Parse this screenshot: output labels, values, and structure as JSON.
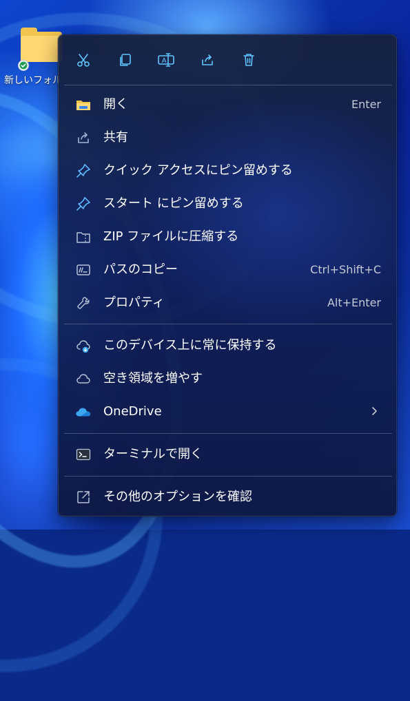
{
  "desktop": {
    "folder_label": "新しいフォル"
  },
  "context_menu": {
    "toolbar": [
      {
        "name": "cut",
        "icon": "scissors-icon"
      },
      {
        "name": "copy",
        "icon": "copy-icon"
      },
      {
        "name": "rename",
        "icon": "rename-icon"
      },
      {
        "name": "share",
        "icon": "share-icon"
      },
      {
        "name": "delete",
        "icon": "trash-icon"
      }
    ],
    "items": [
      {
        "label": "開く",
        "shortcut": "Enter",
        "icon": "folder-open-icon"
      },
      {
        "label": "共有",
        "shortcut": "",
        "icon": "share-icon"
      },
      {
        "label": "クイック アクセスにピン留めする",
        "shortcut": "",
        "icon": "pin-icon"
      },
      {
        "label": "スタート にピン留めする",
        "shortcut": "",
        "icon": "pin-icon"
      },
      {
        "label": "ZIP ファイルに圧縮する",
        "shortcut": "",
        "icon": "zip-folder-icon"
      },
      {
        "label": "パスのコピー",
        "shortcut": "Ctrl+Shift+C",
        "icon": "copy-path-icon"
      },
      {
        "label": "プロパティ",
        "shortcut": "Alt+Enter",
        "icon": "wrench-icon"
      },
      {
        "label": "このデバイス上に常に保持する",
        "shortcut": "",
        "icon": "cloud-download-icon"
      },
      {
        "label": "空き領域を増やす",
        "shortcut": "",
        "icon": "cloud-outline-icon"
      },
      {
        "label": "OneDrive",
        "shortcut": "",
        "icon": "onedrive-icon",
        "submenu": true
      },
      {
        "label": "ターミナルで開く",
        "shortcut": "",
        "icon": "terminal-icon"
      },
      {
        "label": "その他のオプションを確認",
        "shortcut": "",
        "icon": "more-options-icon"
      }
    ]
  },
  "colors": {
    "accent": "#60c6ff",
    "menu_background": "#16224a",
    "text_primary": "#ffffff",
    "text_secondary": "#c4cad4",
    "folder_yellow": "#f2c44f",
    "onedrive_blue": "#3ca7f0"
  }
}
